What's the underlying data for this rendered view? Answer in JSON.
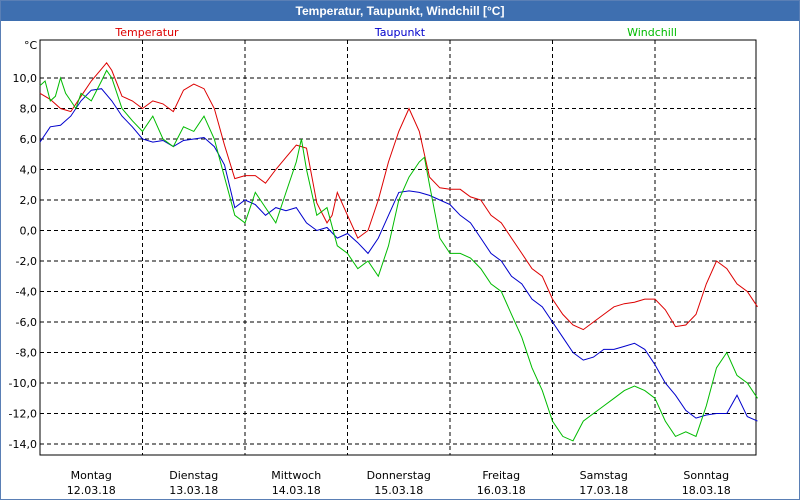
{
  "chart_data": {
    "type": "line",
    "title": "Temperatur, Taupunkt, Windchill [°C]",
    "ylabel": "°C",
    "ylim": [
      -15,
      12
    ],
    "yticks": [
      "10,0",
      "8,0",
      "6,0",
      "4,0",
      "2,0",
      "0,0",
      "-2,0",
      "-4,0",
      "-6,0",
      "-8,0",
      "-10,0",
      "-12,0",
      "-14,0"
    ],
    "ytick_values": [
      10,
      8,
      6,
      4,
      2,
      0,
      -2,
      -4,
      -6,
      -8,
      -10,
      -12,
      -14
    ],
    "xlim": [
      0,
      7
    ],
    "days": [
      {
        "name": "Montag",
        "date": "12.03.18"
      },
      {
        "name": "Dienstag",
        "date": "13.03.18"
      },
      {
        "name": "Mittwoch",
        "date": "14.03.18"
      },
      {
        "name": "Donnerstag",
        "date": "15.03.18"
      },
      {
        "name": "Freitag",
        "date": "16.03.18"
      },
      {
        "name": "Samstag",
        "date": "17.03.18"
      },
      {
        "name": "Sonntag",
        "date": "18.03.18"
      }
    ],
    "grid": true,
    "legend_position": "top",
    "series": [
      {
        "name": "Temperatur",
        "color": "#dd0000",
        "x": [
          0,
          0.1,
          0.2,
          0.3,
          0.4,
          0.5,
          0.6,
          0.65,
          0.7,
          0.8,
          0.9,
          1.0,
          1.1,
          1.2,
          1.3,
          1.4,
          1.5,
          1.6,
          1.7,
          1.75,
          1.8,
          1.9,
          2.0,
          2.1,
          2.2,
          2.3,
          2.4,
          2.5,
          2.6,
          2.7,
          2.8,
          2.85,
          2.9,
          3.0,
          3.1,
          3.2,
          3.3,
          3.4,
          3.5,
          3.6,
          3.7,
          3.75,
          3.8,
          3.9,
          4.0,
          4.1,
          4.2,
          4.3,
          4.4,
          4.5,
          4.6,
          4.7,
          4.8,
          4.9,
          5.0,
          5.1,
          5.2,
          5.3,
          5.4,
          5.5,
          5.6,
          5.7,
          5.8,
          5.9,
          6.0,
          6.1,
          6.2,
          6.3,
          6.4,
          6.5,
          6.6,
          6.7,
          6.8,
          6.9,
          7.0
        ],
        "values": [
          9.0,
          8.6,
          8.0,
          7.8,
          8.8,
          9.8,
          10.6,
          11.0,
          10.5,
          8.8,
          8.5,
          8.0,
          8.5,
          8.3,
          7.8,
          9.2,
          9.6,
          9.3,
          8.0,
          6.8,
          5.6,
          3.4,
          3.6,
          3.6,
          3.1,
          4.0,
          4.8,
          5.6,
          5.4,
          1.8,
          0.5,
          1.0,
          2.5,
          1.0,
          -0.5,
          0.0,
          2.0,
          4.5,
          6.5,
          8.0,
          6.5,
          5.0,
          3.5,
          2.8,
          2.7,
          2.7,
          2.2,
          2.0,
          1.0,
          0.5,
          -0.5,
          -1.5,
          -2.5,
          -3.0,
          -4.5,
          -5.5,
          -6.2,
          -6.5,
          -6.0,
          -5.5,
          -5.0,
          -4.8,
          -4.7,
          -4.5,
          -4.5,
          -5.2,
          -6.3,
          -6.2,
          -5.5,
          -3.5,
          -2.0,
          -2.5,
          -3.5,
          -4.0,
          -5.0
        ]
      },
      {
        "name": "Taupunkt",
        "color": "#0000cc",
        "x": [
          0,
          0.1,
          0.2,
          0.3,
          0.4,
          0.5,
          0.6,
          0.7,
          0.8,
          0.9,
          1.0,
          1.1,
          1.2,
          1.3,
          1.4,
          1.5,
          1.6,
          1.7,
          1.8,
          1.9,
          2.0,
          2.1,
          2.2,
          2.3,
          2.4,
          2.5,
          2.6,
          2.7,
          2.8,
          2.9,
          3.0,
          3.1,
          3.2,
          3.3,
          3.4,
          3.5,
          3.6,
          3.7,
          3.8,
          3.9,
          4.0,
          4.1,
          4.2,
          4.3,
          4.4,
          4.5,
          4.6,
          4.7,
          4.8,
          4.9,
          5.0,
          5.1,
          5.2,
          5.3,
          5.4,
          5.5,
          5.6,
          5.7,
          5.8,
          5.9,
          6.0,
          6.1,
          6.2,
          6.3,
          6.4,
          6.5,
          6.6,
          6.7,
          6.8,
          6.9,
          7.0
        ],
        "values": [
          5.8,
          6.8,
          6.9,
          7.5,
          8.5,
          9.2,
          9.3,
          8.5,
          7.5,
          6.8,
          6.0,
          5.8,
          5.9,
          5.5,
          5.9,
          6.0,
          6.1,
          5.5,
          4.3,
          1.5,
          2.0,
          1.7,
          1.0,
          1.5,
          1.3,
          1.5,
          0.5,
          0.0,
          0.2,
          -0.5,
          -0.2,
          -0.8,
          -1.5,
          -0.5,
          1.0,
          2.5,
          2.6,
          2.5,
          2.3,
          2.0,
          1.7,
          1.0,
          0.5,
          -0.5,
          -1.5,
          -2.0,
          -3.0,
          -3.5,
          -4.5,
          -5.0,
          -6.0,
          -7.0,
          -8.0,
          -8.5,
          -8.3,
          -7.8,
          -7.8,
          -7.6,
          -7.4,
          -7.8,
          -8.8,
          -10.0,
          -10.8,
          -11.8,
          -12.3,
          -12.1,
          -12.0,
          -12.0,
          -10.8,
          -12.2,
          -12.5
        ]
      },
      {
        "name": "Windchill",
        "color": "#00bb00",
        "x": [
          0,
          0.05,
          0.1,
          0.15,
          0.2,
          0.25,
          0.3,
          0.35,
          0.4,
          0.5,
          0.6,
          0.65,
          0.7,
          0.8,
          0.9,
          1.0,
          1.1,
          1.2,
          1.3,
          1.4,
          1.5,
          1.6,
          1.7,
          1.8,
          1.9,
          2.0,
          2.1,
          2.2,
          2.3,
          2.4,
          2.5,
          2.55,
          2.6,
          2.7,
          2.8,
          2.9,
          3.0,
          3.1,
          3.2,
          3.3,
          3.4,
          3.5,
          3.6,
          3.7,
          3.75,
          3.8,
          3.9,
          4.0,
          4.1,
          4.2,
          4.3,
          4.4,
          4.5,
          4.6,
          4.7,
          4.8,
          4.9,
          5.0,
          5.1,
          5.2,
          5.3,
          5.4,
          5.5,
          5.6,
          5.7,
          5.8,
          5.9,
          6.0,
          6.1,
          6.2,
          6.3,
          6.4,
          6.5,
          6.6,
          6.7,
          6.8,
          6.9,
          7.0
        ],
        "values": [
          9.5,
          9.8,
          8.5,
          8.8,
          10.0,
          9.0,
          8.5,
          8.0,
          9.0,
          8.5,
          9.8,
          10.5,
          10.0,
          8.0,
          7.2,
          6.5,
          7.5,
          6.0,
          5.5,
          6.8,
          6.5,
          7.5,
          6.0,
          3.5,
          1.0,
          0.5,
          2.5,
          1.5,
          0.5,
          2.5,
          4.5,
          6.0,
          4.0,
          1.0,
          1.5,
          -1.0,
          -1.5,
          -2.5,
          -2.0,
          -3.0,
          -1.0,
          2.0,
          3.5,
          4.5,
          4.8,
          3.0,
          -0.5,
          -1.5,
          -1.5,
          -1.8,
          -2.5,
          -3.5,
          -4.0,
          -5.5,
          -7.0,
          -9.0,
          -10.5,
          -12.5,
          -13.5,
          -13.8,
          -12.5,
          -12.0,
          -11.5,
          -11.0,
          -10.5,
          -10.2,
          -10.5,
          -11.0,
          -12.5,
          -13.5,
          -13.2,
          -13.5,
          -11.5,
          -9.0,
          -8.0,
          -9.5,
          -10.0,
          -11.0
        ]
      }
    ]
  }
}
